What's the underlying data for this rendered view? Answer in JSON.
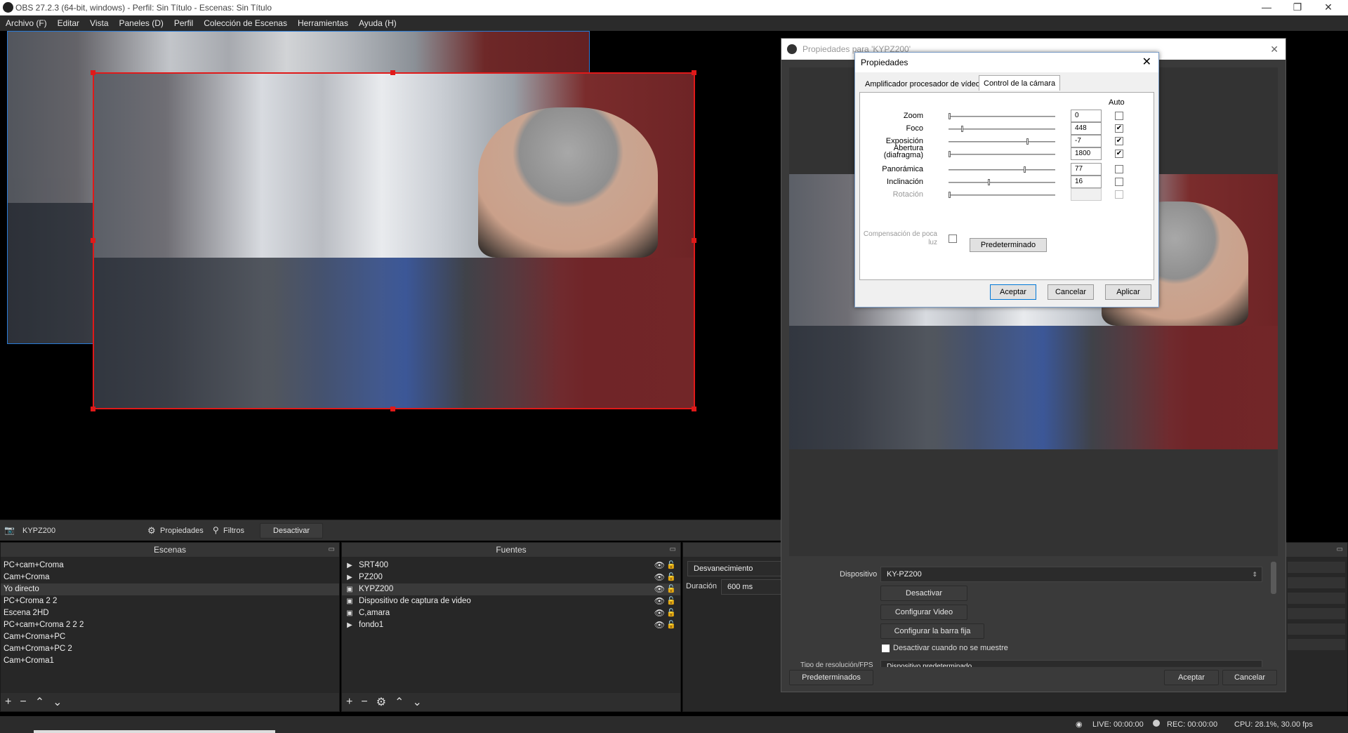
{
  "window": {
    "title": "OBS 27.2.3 (64-bit, windows) - Perfil: Sin Título - Escenas: Sin Título"
  },
  "menu": [
    "Archivo (F)",
    "Editar",
    "Vista",
    "Paneles (D)",
    "Perfil",
    "Colección de Escenas",
    "Herramientas",
    "Ayuda (H)"
  ],
  "source_bar": {
    "name": "KYPZ200",
    "properties": "Propiedades",
    "filters": "Filtros",
    "deactivate": "Desactivar"
  },
  "scenes": {
    "title": "Escenas",
    "items": [
      "PC+cam+Croma",
      "Cam+Croma",
      "Yo directo",
      "PC+Croma 2 2",
      "Escena 2HD",
      "PC+cam+Croma 2 2 2",
      "Cam+Croma+PC",
      "Cam+Croma+PC 2",
      "Cam+Croma1"
    ],
    "selected": 2
  },
  "sources": {
    "title": "Fuentes",
    "items": [
      {
        "name": "SRT400",
        "icon": "play-icon"
      },
      {
        "name": "PZ200",
        "icon": "play-icon"
      },
      {
        "name": "KYPZ200",
        "icon": "camera-icon"
      },
      {
        "name": "Dispositivo de captura de video",
        "icon": "camera-icon"
      },
      {
        "name": "C,amara",
        "icon": "camera-icon"
      },
      {
        "name": "fondo1",
        "icon": "play-icon"
      }
    ],
    "selected": 2
  },
  "transitions": {
    "type": "Desvanecimiento",
    "duration_label": "Duración",
    "duration": "600 ms"
  },
  "status": {
    "live": "LIVE: 00:00:00",
    "rec": "REC: 00:00:00",
    "cpu": "CPU: 28.1%, 30.00 fps"
  },
  "props_window": {
    "title": "Propiedades para 'KYPZ200'",
    "device_label": "Dispositivo",
    "device_value": "KY-PZ200",
    "deactivate": "Desactivar",
    "configure_video": "Configurar Video",
    "configure_crossbar": "Configurar la barra fija",
    "deactivate_hidden": "Desactivar cuando no se muestre",
    "resolution_label": "Tipo de resolución/FPS",
    "resolution_value": "Dispositivo predeterminado",
    "defaults": "Predeterminados",
    "accept": "Aceptar",
    "cancel": "Cancelar"
  },
  "dialog": {
    "title": "Propiedades",
    "tab1": "Amplificador procesador de vídeo",
    "tab2": "Control de la cámara",
    "auto": "Auto",
    "rows": [
      {
        "label": "Zoom",
        "value": "0",
        "pos": 0.0,
        "auto": false,
        "disabled": false
      },
      {
        "label": "Foco",
        "value": "448",
        "pos": 0.12,
        "auto": true,
        "disabled": false
      },
      {
        "label": "Exposición",
        "value": "-7",
        "pos": 0.75,
        "auto": true,
        "disabled": false
      },
      {
        "label": "Abertura (diafragma)",
        "value": "1800",
        "pos": 0.0,
        "auto": true,
        "disabled": false
      },
      {
        "label": "Panorámica",
        "value": "77",
        "pos": 0.72,
        "auto": false,
        "disabled": false
      },
      {
        "label": "Inclinación",
        "value": "16",
        "pos": 0.38,
        "auto": false,
        "disabled": false
      },
      {
        "label": "Rotación",
        "value": "",
        "pos": 0.0,
        "auto": false,
        "disabled": true
      }
    ],
    "lowlight": "Compensación de poca luz",
    "default_btn": "Predeterminado",
    "accept": "Aceptar",
    "cancel": "Cancelar",
    "apply": "Aplicar"
  }
}
